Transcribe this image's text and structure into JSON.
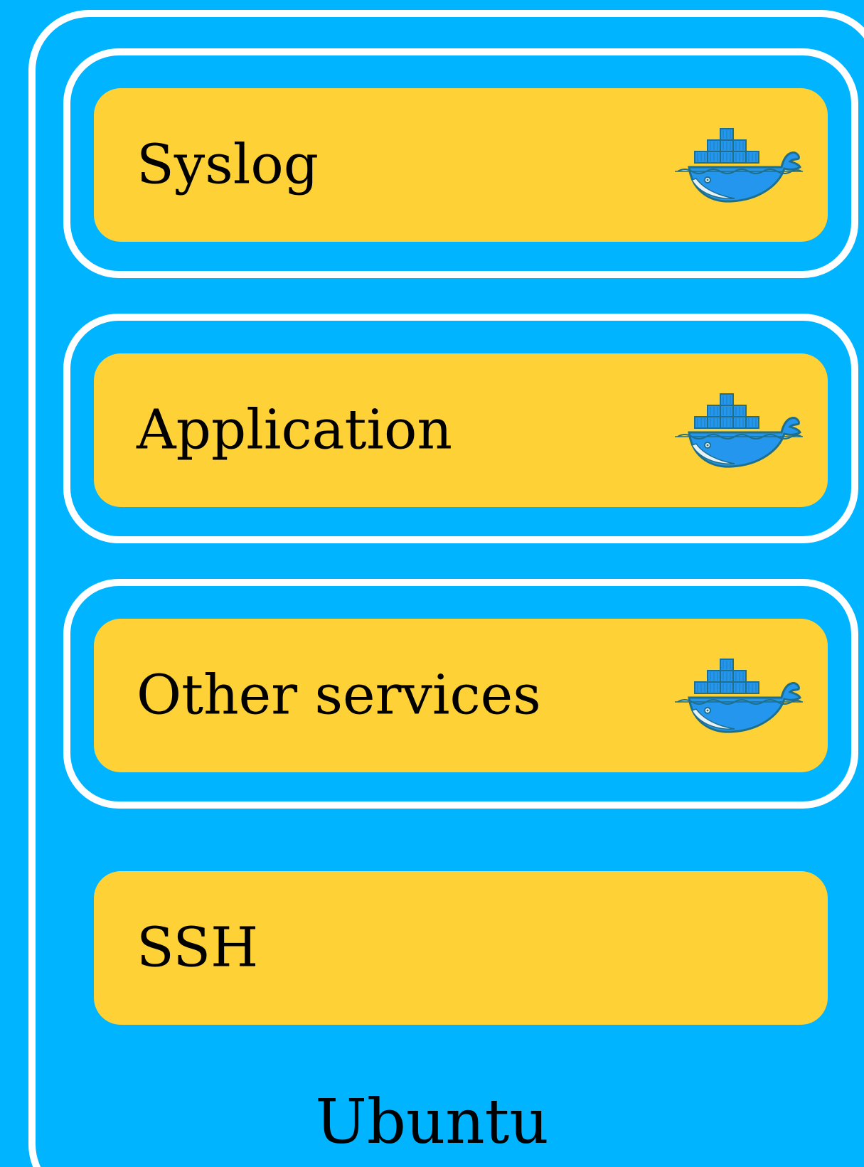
{
  "host": {
    "label": "Ubuntu",
    "border_color": "#ffffff",
    "background_color": "#00b4ff"
  },
  "services": [
    {
      "label": "Syslog",
      "containerized": true,
      "icon": "docker-whale-icon"
    },
    {
      "label": "Application",
      "containerized": true,
      "icon": "docker-whale-icon"
    },
    {
      "label": "Other services",
      "containerized": true,
      "icon": "docker-whale-icon"
    },
    {
      "label": "SSH",
      "containerized": false
    }
  ],
  "colors": {
    "service_fill": "#fed136",
    "docker_blue": "#2496ed",
    "docker_dark": "#1f6f8b"
  }
}
